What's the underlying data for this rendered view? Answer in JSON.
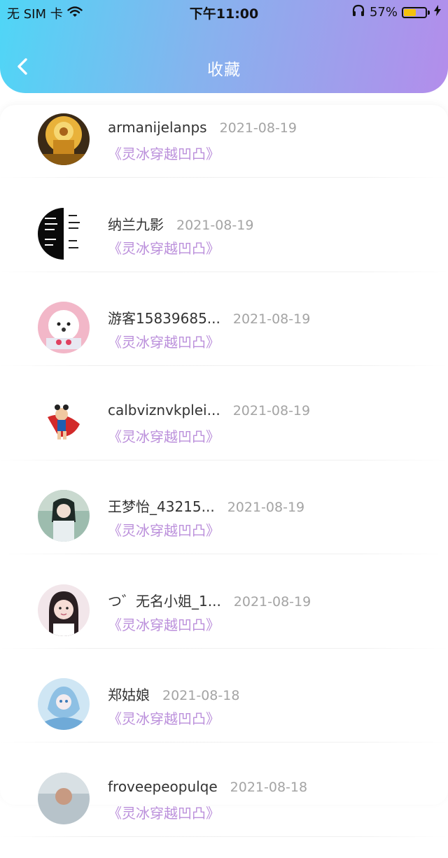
{
  "statusbar": {
    "carrier": "无 SIM 卡",
    "time": "下午11:00",
    "battery_text": "57%",
    "battery_level": 0.57
  },
  "header": {
    "title": "收藏"
  },
  "items": [
    {
      "name": "armanijelanps",
      "date": "2021-08-19",
      "book": "《灵冰穿越凹凸》",
      "avatar": "avatar-buddha"
    },
    {
      "name": "纳兰九影",
      "date": "2021-08-19",
      "book": "《灵冰穿越凹凸》",
      "avatar": "avatar-text"
    },
    {
      "name": "游客15839685...",
      "date": "2021-08-19",
      "book": "《灵冰穿越凹凸》",
      "avatar": "avatar-dog"
    },
    {
      "name": "calbviznvkplei...",
      "date": "2021-08-19",
      "book": "《灵冰穿越凹凸》",
      "avatar": "avatar-nezha"
    },
    {
      "name": "王梦怡_43215...",
      "date": "2021-08-19",
      "book": "《灵冰穿越凹凸》",
      "avatar": "avatar-anime"
    },
    {
      "name": "つ゛无名小姐_1...",
      "date": "2021-08-19",
      "book": "《灵冰穿越凹凸》",
      "avatar": "avatar-girl"
    },
    {
      "name": "郑姑娘",
      "date": "2021-08-18",
      "book": "《灵冰穿越凹凸》",
      "avatar": "avatar-blue"
    },
    {
      "name": "froveepeopulqe",
      "date": "2021-08-18",
      "book": "《灵冰穿越凹凸》",
      "avatar": "avatar-photo"
    }
  ]
}
